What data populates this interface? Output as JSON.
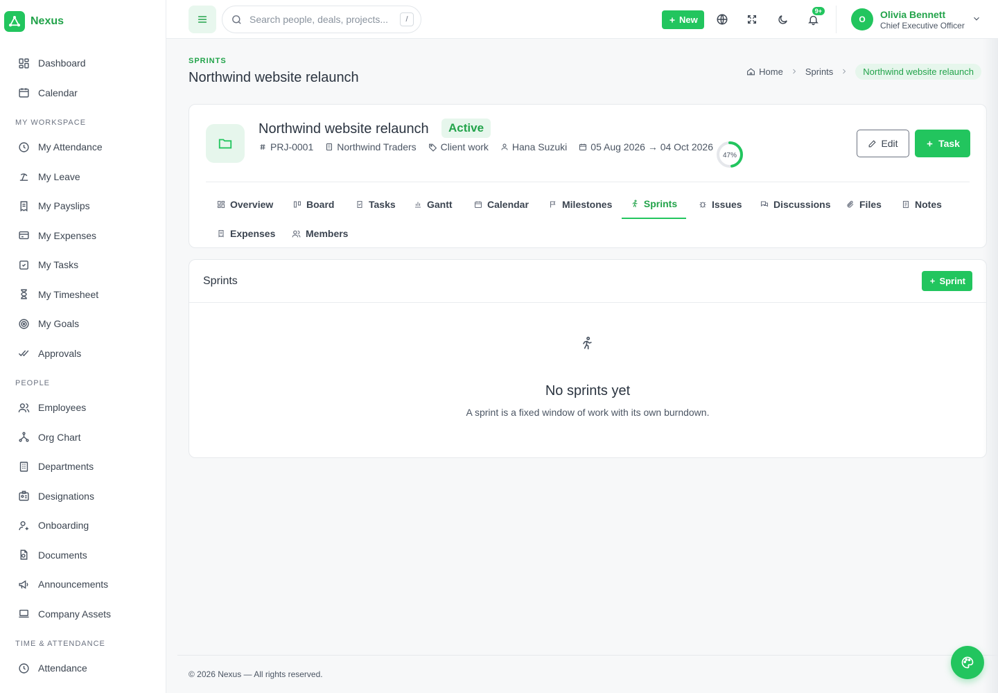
{
  "app": {
    "name": "Nexus"
  },
  "sidebar": {
    "top_items": [
      {
        "label": "Dashboard",
        "icon": "dashboard-icon"
      },
      {
        "label": "Calendar",
        "icon": "calendar-icon"
      }
    ],
    "sections": [
      {
        "title": "MY WORKSPACE",
        "items": [
          {
            "label": "My Attendance",
            "icon": "clock-icon"
          },
          {
            "label": "My Leave",
            "icon": "beach-icon"
          },
          {
            "label": "My Payslips",
            "icon": "receipt-icon"
          },
          {
            "label": "My Expenses",
            "icon": "card-icon"
          },
          {
            "label": "My Tasks",
            "icon": "checkbox-icon"
          },
          {
            "label": "My Timesheet",
            "icon": "hourglass-icon"
          },
          {
            "label": "My Goals",
            "icon": "target-icon"
          },
          {
            "label": "Approvals",
            "icon": "double-check-icon"
          }
        ]
      },
      {
        "title": "PEOPLE",
        "items": [
          {
            "label": "Employees",
            "icon": "users-icon"
          },
          {
            "label": "Org Chart",
            "icon": "org-chart-icon"
          },
          {
            "label": "Departments",
            "icon": "building-icon"
          },
          {
            "label": "Designations",
            "icon": "id-badge-icon"
          },
          {
            "label": "Onboarding",
            "icon": "user-plus-icon"
          },
          {
            "label": "Documents",
            "icon": "document-icon"
          },
          {
            "label": "Announcements",
            "icon": "megaphone-icon"
          },
          {
            "label": "Company Assets",
            "icon": "laptop-icon"
          }
        ]
      },
      {
        "title": "TIME & ATTENDANCE",
        "items": [
          {
            "label": "Attendance",
            "icon": "clock-icon"
          }
        ]
      }
    ]
  },
  "header": {
    "search_placeholder": "Search people, deals, projects...",
    "search_shortcut": "/",
    "new_label": "New",
    "notification_count": "9+",
    "user": {
      "initial": "O",
      "name": "Olivia Bennett",
      "role": "Chief Executive Officer"
    }
  },
  "page": {
    "eyebrow": "SPRINTS",
    "title": "Northwind website relaunch",
    "breadcrumb": [
      "Home",
      "Sprints",
      "Northwind website relaunch"
    ]
  },
  "project": {
    "name": "Northwind website relaunch",
    "status": "Active",
    "code": "PRJ-0001",
    "client": "Northwind Traders",
    "category": "Client work",
    "owner": "Hana Suzuki",
    "dates": "05 Aug 2026 → 04 Oct 2026",
    "progress_label": "47%",
    "progress_value": 0.47,
    "edit_label": "Edit",
    "task_label": "Task",
    "tabs": [
      {
        "label": "Overview",
        "icon": "grid-icon"
      },
      {
        "label": "Board",
        "icon": "kanban-icon"
      },
      {
        "label": "Tasks",
        "icon": "task-list-icon"
      },
      {
        "label": "Gantt",
        "icon": "bar-chart-icon"
      },
      {
        "label": "Calendar",
        "icon": "calendar-icon"
      },
      {
        "label": "Milestones",
        "icon": "flag-icon"
      },
      {
        "label": "Sprints",
        "icon": "runner-icon",
        "active": true
      },
      {
        "label": "Issues",
        "icon": "bug-icon"
      },
      {
        "label": "Discussions",
        "icon": "chat-icon"
      },
      {
        "label": "Files",
        "icon": "paperclip-icon"
      },
      {
        "label": "Notes",
        "icon": "note-icon"
      },
      {
        "label": "Expenses",
        "icon": "receipt-icon"
      },
      {
        "label": "Members",
        "icon": "users-icon"
      }
    ]
  },
  "sprints": {
    "title": "Sprints",
    "add_label": "Sprint",
    "empty_title": "No sprints yet",
    "empty_desc": "A sprint is a fixed window of work with its own burndown."
  },
  "footer": {
    "text": "© 2026 Nexus — All rights reserved."
  },
  "colors": {
    "accent": "#22c55e",
    "accent_dark": "#22a34a",
    "accent_soft": "#e6f6ec"
  }
}
